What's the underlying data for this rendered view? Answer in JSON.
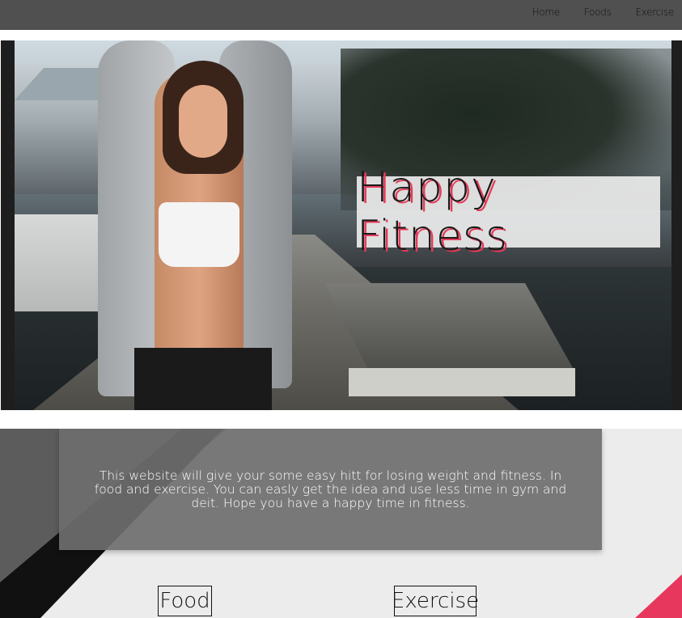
{
  "nav": {
    "items": [
      {
        "label": "Home"
      },
      {
        "label": "Foods"
      },
      {
        "label": "Exercise"
      }
    ]
  },
  "hero": {
    "title": "Happy Fitness"
  },
  "intro": {
    "text": "This website will give your some easy hitt for losing weight and fitness. In food and exercise. You can easly get the idea and use less time in gym and deit. Hope you have a happy time in fitness."
  },
  "links": {
    "food": "Food",
    "exercise": "Exercise"
  },
  "colors": {
    "topbar": "#505050",
    "accent_pink": "#e8375c",
    "section_bg": "#ececec",
    "intro_box": "#6e6e6e"
  }
}
